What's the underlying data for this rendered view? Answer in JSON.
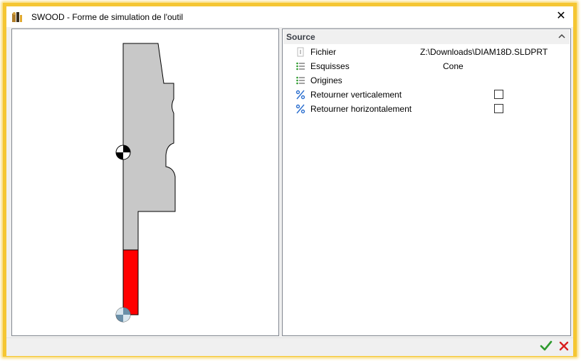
{
  "window": {
    "title": "SWOOD - Forme de simulation de l'outil",
    "close_label": "✕"
  },
  "source_section": {
    "title": "Source",
    "rows": [
      {
        "label": "Fichier",
        "value": "Z:\\Downloads\\DIAM18D.SLDPRT",
        "icon": "file-icon"
      },
      {
        "label": "Esquisses",
        "value": "Cone",
        "icon": "sketch-list-icon"
      },
      {
        "label": "Origines",
        "value": "",
        "icon": "origin-list-icon"
      },
      {
        "label": "Retourner verticalement",
        "checked": false,
        "icon": "flip-vertical-icon"
      },
      {
        "label": "Retourner horizontalement",
        "checked": false,
        "icon": "flip-horizontal-icon"
      }
    ]
  },
  "colors": {
    "frame": "#f5c633",
    "tool_body": "#c8c8c8",
    "cutting_part": "#ff0000",
    "ok": "#2e9a2e",
    "cancel": "#d81e1e"
  }
}
